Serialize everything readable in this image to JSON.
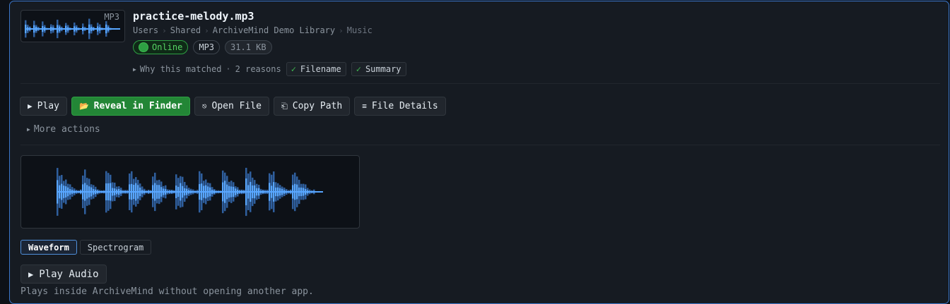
{
  "file": {
    "name": "practice-melody.mp3",
    "thumb_label": "MP3",
    "breadcrumb": [
      "Users",
      "Shared",
      "ArchiveMind Demo Library",
      "Music"
    ],
    "badges": {
      "status": "Online",
      "format": "MP3",
      "size": "31.1 KB"
    }
  },
  "match": {
    "label": "Why this matched",
    "count": "2 reasons",
    "reasons": [
      "Filename",
      "Summary"
    ]
  },
  "actions": [
    {
      "label": "Play",
      "icon": "play-icon",
      "glyph": "▶"
    },
    {
      "label": "Reveal in Finder",
      "icon": "folder-icon",
      "glyph": "📂"
    },
    {
      "label": "Open File",
      "icon": "open-file-icon",
      "glyph": "⎋"
    },
    {
      "label": "Copy Path",
      "icon": "copy-icon",
      "glyph": "⎗"
    },
    {
      "label": "File Details",
      "icon": "list-icon",
      "glyph": "≡"
    }
  ],
  "more_actions": "More actions",
  "preview": {
    "tabs": [
      "Waveform",
      "Spectrogram"
    ],
    "active_tab": "Waveform",
    "play_audio": "Play Audio",
    "play_glyph": "▶",
    "note": "Plays inside ArchiveMind without opening another app."
  },
  "colors": {
    "accent": "#3b76c9",
    "primary_button": "#238636",
    "online": "#2ea043",
    "waveform_bright": "#58a6ff",
    "waveform_dim": "#2f5f9e"
  }
}
